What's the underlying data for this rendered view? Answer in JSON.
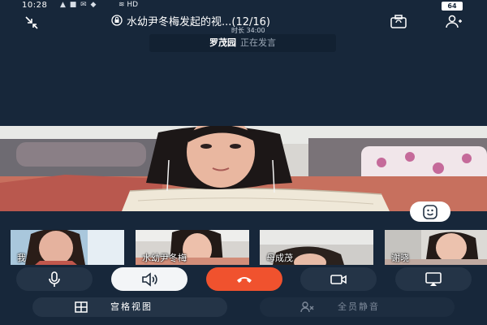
{
  "status_bar": {
    "time": "10:28",
    "icons_text": "▲ ■ ✉ ◆",
    "network": "HD",
    "battery": "64"
  },
  "header": {
    "title": "水幼尹冬梅发起的视...(12/16)",
    "duration": "时长 34:00",
    "icons": [
      "collapse-icon",
      "lock-icon",
      "camera-switch-icon",
      "participants-icon"
    ]
  },
  "speaking": {
    "name": "罗茂园",
    "status": "正在发言"
  },
  "thumbnails": [
    {
      "label": "我"
    },
    {
      "label": "水幼尹冬梅"
    },
    {
      "label": "母成茂"
    },
    {
      "label": "谢晓"
    }
  ],
  "controls": {
    "icons": [
      "microphone-icon",
      "speaker-icon",
      "hang-up-icon",
      "video-camera-icon",
      "screen-share-icon"
    ],
    "colors": {
      "hangup": "#f0522e",
      "background": "#17273a",
      "button": "#243447"
    }
  },
  "bottom_bar": {
    "grid_view": "宫格视图",
    "mute_all": "全员静音"
  }
}
